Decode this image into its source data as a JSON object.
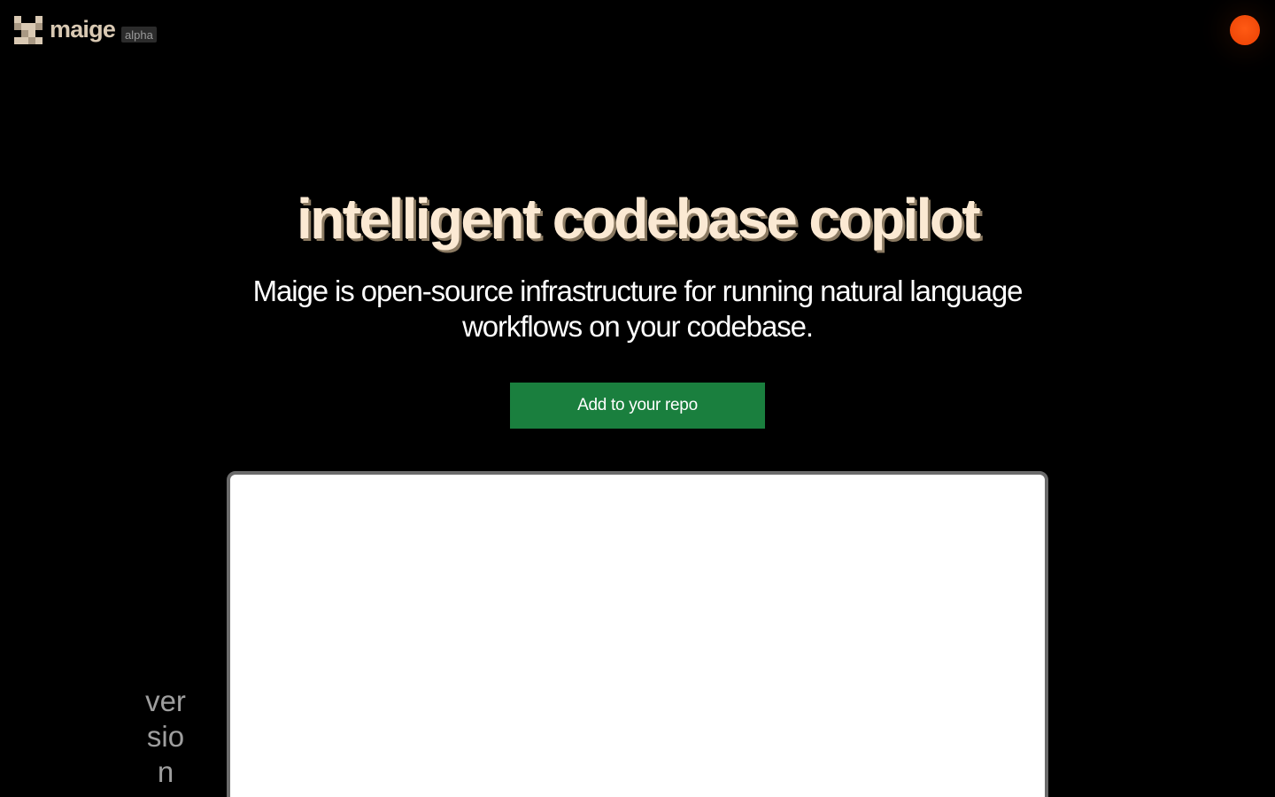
{
  "header": {
    "logo_text": "maige",
    "badge": "alpha",
    "logo_icon": "pixel-grid-logo-icon",
    "avatar_icon": "user-avatar-icon"
  },
  "hero": {
    "title": "intelligent codebase copilot",
    "subtitle": "Maige is open-source infrastructure for running natural language workflows on your codebase.",
    "cta_label": "Add to your repo"
  },
  "version": {
    "label": "version"
  },
  "colors": {
    "background": "#000000",
    "title": "#fbe9d3",
    "logo": "#d9c9b3",
    "cta": "#1a7f3e",
    "avatar": "#ff5a14",
    "version_text": "#9e9e9e",
    "frame_border": "#6b6b6b"
  }
}
